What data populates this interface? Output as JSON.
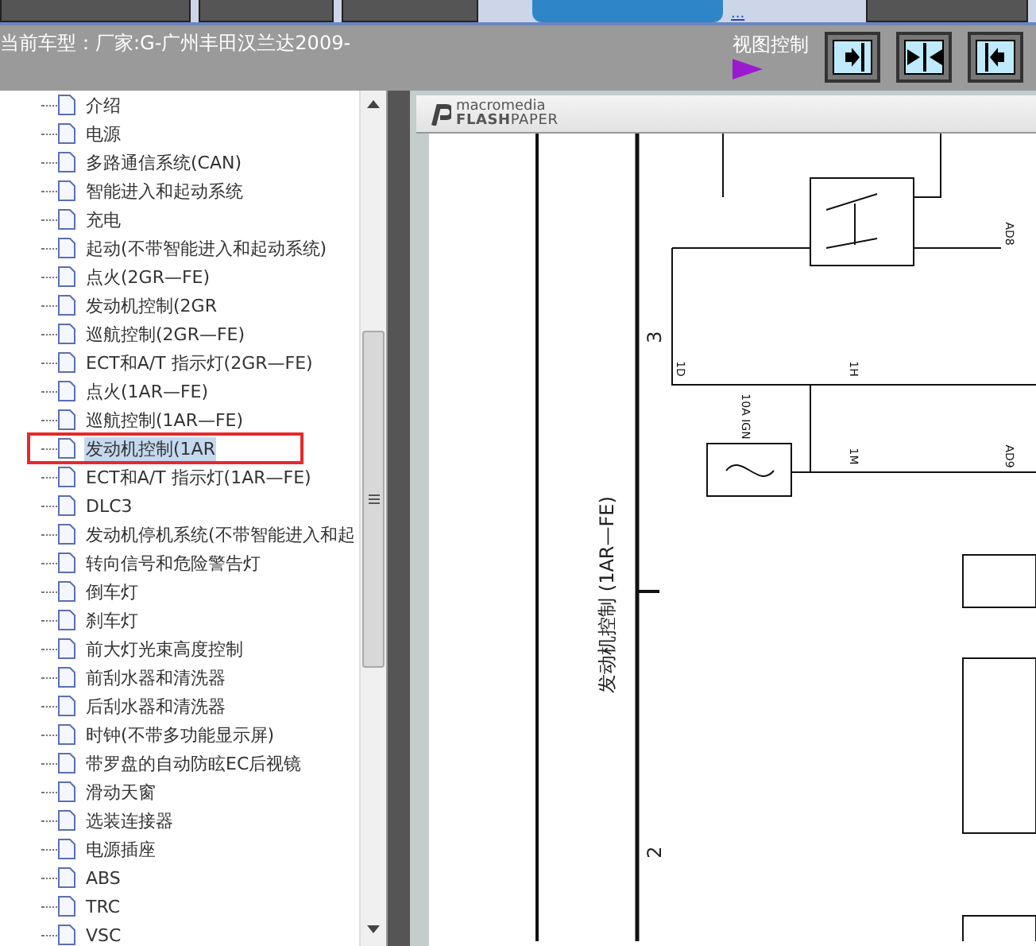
{
  "top_strip": {
    "tabs": [
      {
        "selected": false
      },
      {
        "selected": false
      },
      {
        "selected": false
      },
      {
        "selected": true
      },
      {
        "selected": false
      }
    ],
    "link": "..."
  },
  "header": {
    "model_label": "当前车型：厂家:G-广州丰田汉兰达2009-",
    "view_control": "视图控制"
  },
  "tree": {
    "items": [
      {
        "label": "介绍",
        "selected": false,
        "marked": false
      },
      {
        "label": "电源",
        "selected": false,
        "marked": false
      },
      {
        "label": "多路通信系统(CAN)",
        "selected": false,
        "marked": false
      },
      {
        "label": "智能进入和起动系统",
        "selected": false,
        "marked": false
      },
      {
        "label": "充电",
        "selected": false,
        "marked": false
      },
      {
        "label": "起动(不带智能进入和起动系统)",
        "selected": false,
        "marked": false
      },
      {
        "label": "点火(2GR—FE)",
        "selected": false,
        "marked": false
      },
      {
        "label": "发动机控制(2GR",
        "selected": false,
        "marked": false
      },
      {
        "label": "巡航控制(2GR—FE)",
        "selected": false,
        "marked": false
      },
      {
        "label": "ECT和A/T 指示灯(2GR—FE)",
        "selected": false,
        "marked": false
      },
      {
        "label": "点火(1AR—FE)",
        "selected": false,
        "marked": false
      },
      {
        "label": "巡航控制(1AR—FE)",
        "selected": false,
        "marked": false
      },
      {
        "label": "发动机控制(1AR",
        "selected": true,
        "marked": true
      },
      {
        "label": "ECT和A/T 指示灯(1AR—FE)",
        "selected": false,
        "marked": false
      },
      {
        "label": "DLC3",
        "selected": false,
        "marked": false
      },
      {
        "label": "发动机停机系统(不带智能进入和起",
        "selected": false,
        "marked": false
      },
      {
        "label": "转向信号和危险警告灯",
        "selected": false,
        "marked": false
      },
      {
        "label": "倒车灯",
        "selected": false,
        "marked": false
      },
      {
        "label": "刹车灯",
        "selected": false,
        "marked": false
      },
      {
        "label": "前大灯光束高度控制",
        "selected": false,
        "marked": false
      },
      {
        "label": "前刮水器和清洗器",
        "selected": false,
        "marked": false
      },
      {
        "label": "后刮水器和清洗器",
        "selected": false,
        "marked": false
      },
      {
        "label": "时钟(不带多功能显示屏)",
        "selected": false,
        "marked": false
      },
      {
        "label": "带罗盘的自动防眩EC后视镜",
        "selected": false,
        "marked": false
      },
      {
        "label": "滑动天窗",
        "selected": false,
        "marked": false
      },
      {
        "label": "选装连接器",
        "selected": false,
        "marked": false
      },
      {
        "label": "电源插座",
        "selected": false,
        "marked": false
      },
      {
        "label": "ABS",
        "selected": false,
        "marked": false
      },
      {
        "label": "TRC",
        "selected": false,
        "marked": false
      },
      {
        "label": "VSC",
        "selected": false,
        "marked": false
      }
    ]
  },
  "viewer": {
    "logo_top": "macromedia",
    "logo_bold": "FLASH",
    "logo_rest": "PAPER",
    "page": {
      "title": "发动机控制 (1AR—FE)",
      "section_numbers": [
        "3",
        "2"
      ],
      "connectors": [
        {
          "label": "1D"
        },
        {
          "label": "1H"
        },
        {
          "label": "1M"
        },
        {
          "label": "AD8"
        },
        {
          "label": "AD9"
        }
      ],
      "fuse": "10A IGN"
    }
  }
}
